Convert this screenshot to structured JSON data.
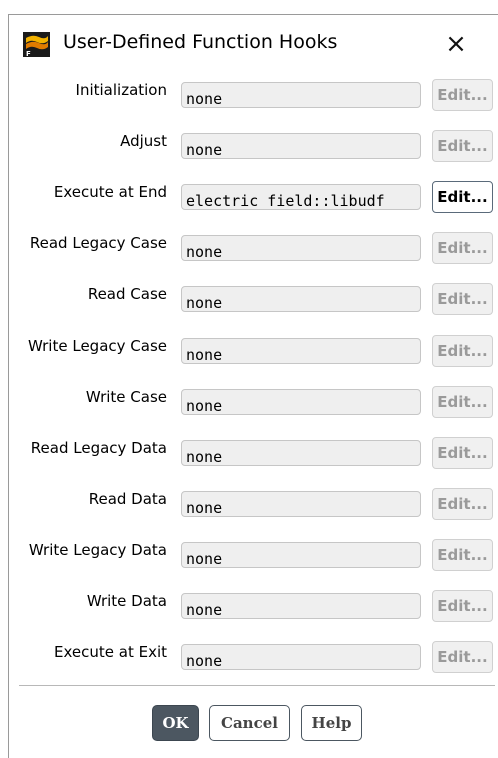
{
  "window": {
    "title": "User-Defined Function Hooks",
    "close_symbol": "×",
    "app_icon": "fluent-app-icon"
  },
  "hooks": [
    {
      "label": "Initialization",
      "value": "none",
      "edit_label": "Edit...",
      "edit_enabled": false
    },
    {
      "label": "Adjust",
      "value": "none",
      "edit_label": "Edit...",
      "edit_enabled": false
    },
    {
      "label": "Execute at End",
      "value": "electric_field::libudf",
      "edit_label": "Edit...",
      "edit_enabled": true
    },
    {
      "label": "Read Legacy Case",
      "value": "none",
      "edit_label": "Edit...",
      "edit_enabled": false
    },
    {
      "label": "Read Case",
      "value": "none",
      "edit_label": "Edit...",
      "edit_enabled": false
    },
    {
      "label": "Write Legacy Case",
      "value": "none",
      "edit_label": "Edit...",
      "edit_enabled": false
    },
    {
      "label": "Write Case",
      "value": "none",
      "edit_label": "Edit...",
      "edit_enabled": false
    },
    {
      "label": "Read Legacy Data",
      "value": "none",
      "edit_label": "Edit...",
      "edit_enabled": false
    },
    {
      "label": "Read Data",
      "value": "none",
      "edit_label": "Edit...",
      "edit_enabled": false
    },
    {
      "label": "Write Legacy Data",
      "value": "none",
      "edit_label": "Edit...",
      "edit_enabled": false
    },
    {
      "label": "Write Data",
      "value": "none",
      "edit_label": "Edit...",
      "edit_enabled": false
    },
    {
      "label": "Execute at Exit",
      "value": "none",
      "edit_label": "Edit...",
      "edit_enabled": false
    }
  ],
  "buttons": {
    "ok": "OK",
    "cancel": "Cancel",
    "help": "Help"
  },
  "colors": {
    "primary_button": "#4c5761",
    "disabled_text": "#9a9a9a",
    "field_bg": "#efefef"
  }
}
